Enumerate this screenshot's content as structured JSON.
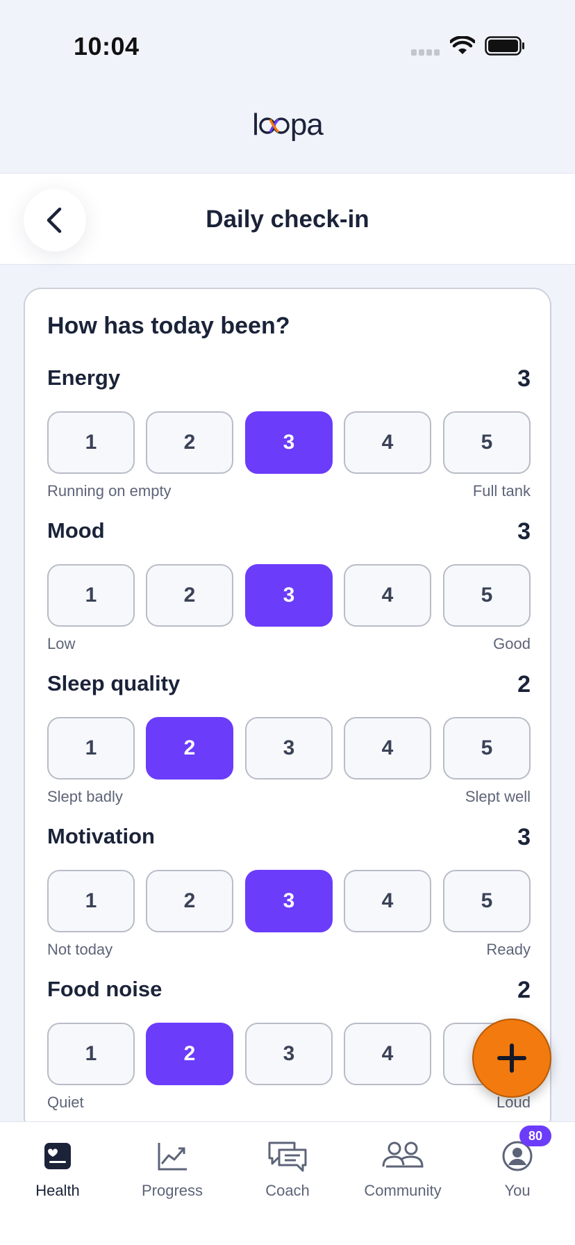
{
  "status_bar": {
    "time": "10:04"
  },
  "brand": {
    "name_left": "l",
    "name_right": "pa"
  },
  "header": {
    "title": "Daily check-in"
  },
  "card": {
    "title": "How has today been?"
  },
  "metrics": [
    {
      "name": "Energy",
      "value": "3",
      "selected": 3,
      "low_label": "Running on empty",
      "high_label": "Full tank"
    },
    {
      "name": "Mood",
      "value": "3",
      "selected": 3,
      "low_label": "Low",
      "high_label": "Good"
    },
    {
      "name": "Sleep quality",
      "value": "2",
      "selected": 2,
      "low_label": "Slept badly",
      "high_label": "Slept well"
    },
    {
      "name": "Motivation",
      "value": "3",
      "selected": 3,
      "low_label": "Not today",
      "high_label": "Ready"
    },
    {
      "name": "Food noise",
      "value": "2",
      "selected": 2,
      "low_label": "Quiet",
      "high_label": "Loud"
    }
  ],
  "scale_options": [
    "1",
    "2",
    "3",
    "4",
    "5"
  ],
  "fab": {
    "icon": "plus-icon"
  },
  "tabs": [
    {
      "label": "Health",
      "icon": "health-icon",
      "active": true
    },
    {
      "label": "Progress",
      "icon": "progress-chart-icon",
      "active": false
    },
    {
      "label": "Coach",
      "icon": "chat-bubbles-icon",
      "active": false
    },
    {
      "label": "Community",
      "icon": "people-icon",
      "active": false
    },
    {
      "label": "You",
      "icon": "profile-icon",
      "active": false
    }
  ],
  "you_badge": "80",
  "colors": {
    "accent": "#6B3CFA",
    "fab": "#F27A0E",
    "text": "#1B2339",
    "background": "#F1F3FB"
  }
}
